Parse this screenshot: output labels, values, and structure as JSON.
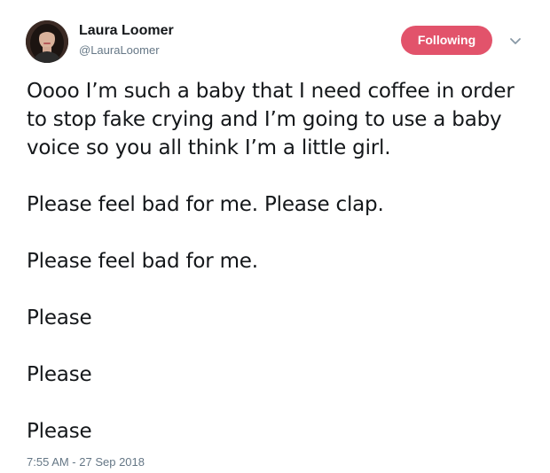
{
  "author": {
    "display_name": "Laura Loomer",
    "handle": "@LauraLoomer",
    "avatar_icon": "profile-photo"
  },
  "follow_button": {
    "label": "Following",
    "color": "#e2536b"
  },
  "menu": {
    "icon": "chevron-down-icon"
  },
  "tweet": {
    "paragraphs": [
      "Oooo I’m such a baby that I need coffee in order to stop fake crying and I’m going to use a baby voice so you all think I’m a little girl.",
      "Please feel bad for me. Please clap.",
      "Please feel bad for me.",
      "Please",
      "Please",
      "Please"
    ],
    "timestamp": "7:55 AM - 27 Sep 2018"
  }
}
